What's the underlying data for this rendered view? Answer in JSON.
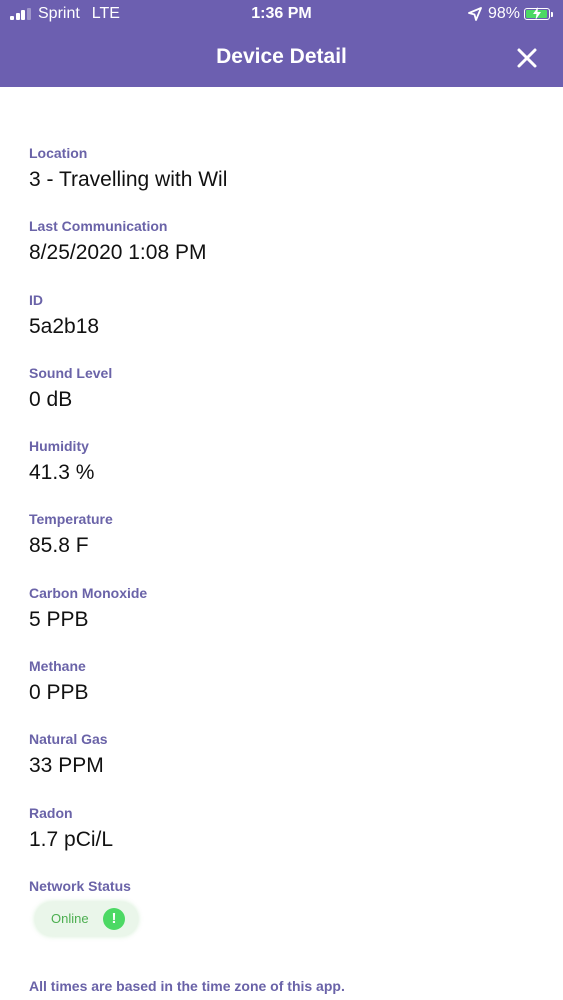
{
  "status_bar": {
    "carrier": "Sprint",
    "network": "LTE",
    "time": "1:36 PM",
    "battery_percent": "98%",
    "signal_bars": 3,
    "battery_level": 0.98,
    "icons": [
      "signal-icon",
      "location-arrow-icon",
      "battery-charging-icon"
    ]
  },
  "header": {
    "title": "Device Detail",
    "close_icon": "close-icon",
    "background_color": "#6c5fb0"
  },
  "fields": [
    {
      "label": "Location",
      "value": "3 - Travelling with Wil"
    },
    {
      "label": "Last Communication",
      "value": "8/25/2020 1:08 PM"
    },
    {
      "label": "ID",
      "value": "5a2b18"
    },
    {
      "label": "Sound Level",
      "value": "0 dB"
    },
    {
      "label": "Humidity",
      "value": "41.3 %"
    },
    {
      "label": "Temperature",
      "value": "85.8 F"
    },
    {
      "label": "Carbon Monoxide",
      "value": "5 PPB"
    },
    {
      "label": "Methane",
      "value": "0 PPB"
    },
    {
      "label": "Natural Gas",
      "value": "33 PPM"
    },
    {
      "label": "Radon",
      "value": "1.7 pCi/L"
    }
  ],
  "network": {
    "label": "Network Status",
    "status": "Online",
    "icon": "exclamation-icon",
    "status_color": "#4caf50"
  },
  "footnote": "All times are based in the time zone of this app."
}
